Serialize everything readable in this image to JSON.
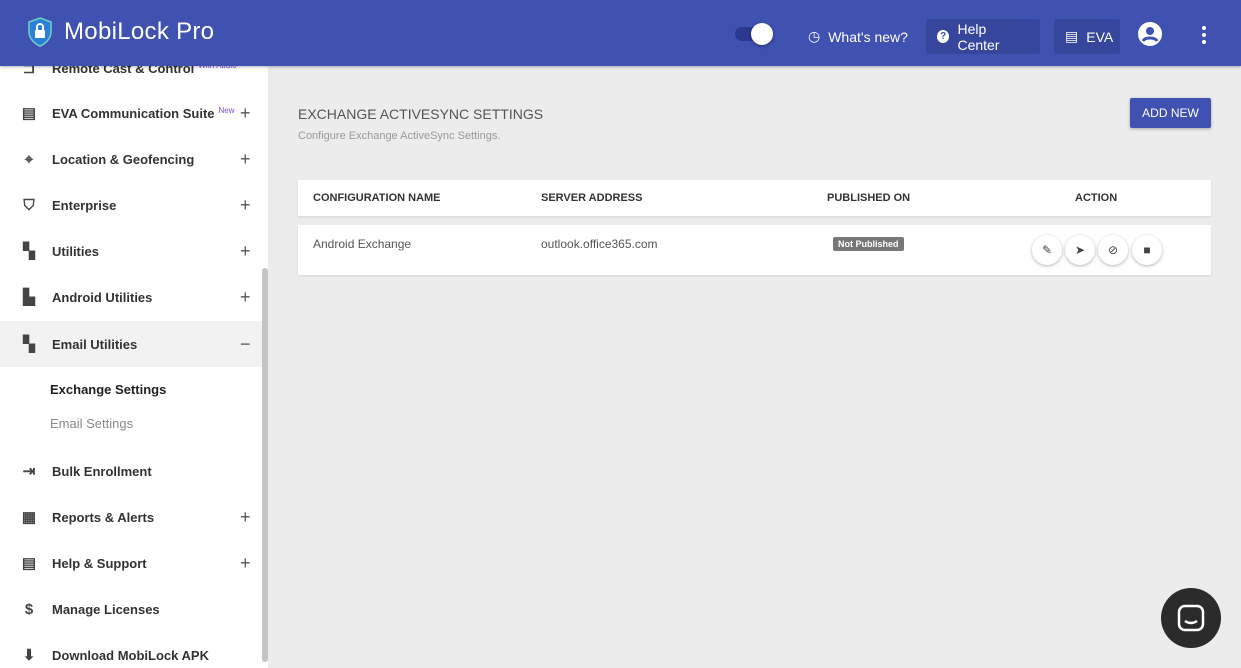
{
  "header": {
    "brand": "MobiLock Pro",
    "whats_new": "What's new?",
    "help_center": "Help Center",
    "eva": "EVA"
  },
  "sidebar": {
    "items": [
      {
        "label": "Remote Cast & Control",
        "badge": "With Audio"
      },
      {
        "label": "EVA Communication Suite",
        "badge": "New"
      },
      {
        "label": "Location & Geofencing"
      },
      {
        "label": "Enterprise"
      },
      {
        "label": "Utilities"
      },
      {
        "label": "Android Utilities"
      },
      {
        "label": "Email Utilities"
      },
      {
        "label": "Bulk Enrollment"
      },
      {
        "label": "Reports & Alerts"
      },
      {
        "label": "Help & Support"
      },
      {
        "label": "Manage Licenses"
      },
      {
        "label": "Download MobiLock APK"
      }
    ],
    "subitems": [
      {
        "label": "Exchange Settings"
      },
      {
        "label": "Email Settings"
      }
    ]
  },
  "main": {
    "title": "EXCHANGE ACTIVESYNC SETTINGS",
    "subtitle": "Configure Exchange ActiveSync Settings.",
    "add_new": "ADD NEW",
    "columns": [
      "CONFIGURATION NAME",
      "SERVER ADDRESS",
      "PUBLISHED ON",
      "ACTION"
    ],
    "rows": [
      {
        "name": "Android Exchange",
        "server": "outlook.office365.com",
        "status": "Not Published"
      }
    ]
  },
  "colors": {
    "brand": "#3f51b1",
    "badge_new": "#7b4fe0"
  }
}
